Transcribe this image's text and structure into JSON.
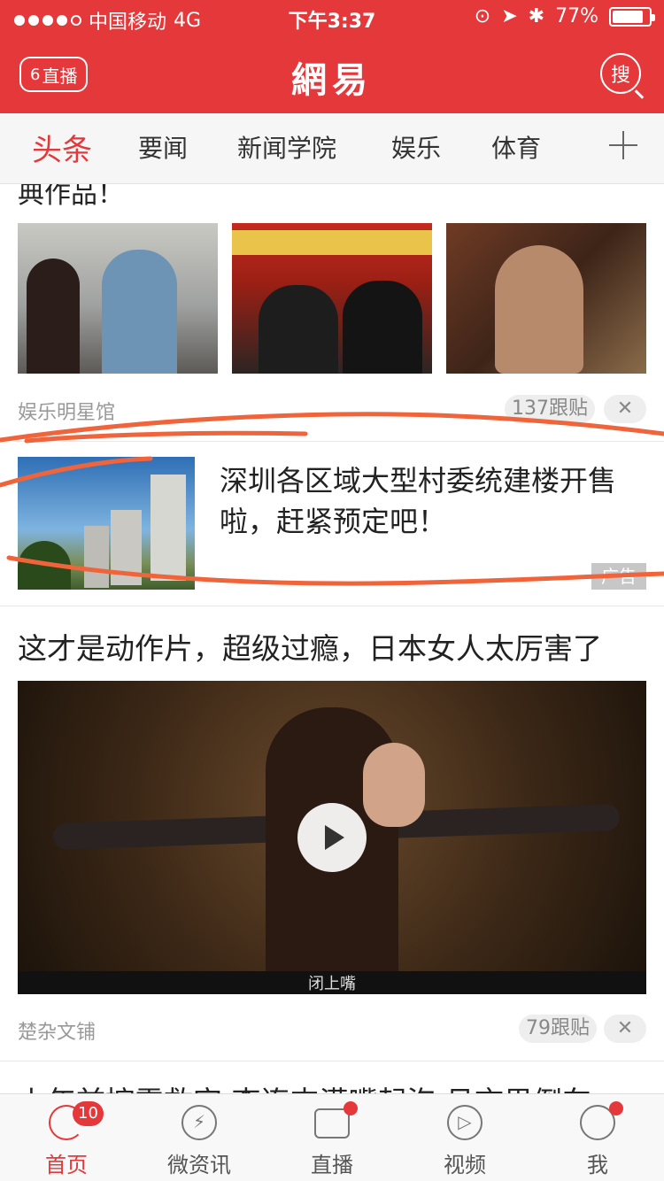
{
  "status_bar": {
    "carrier": "中国移动",
    "network": "4G",
    "time": "下午3:37",
    "battery": "77%"
  },
  "nav": {
    "live_count": "6",
    "live_label": "直播",
    "logo": "網易",
    "search_label": "搜"
  },
  "tabs": [
    {
      "label": "头条",
      "active": true
    },
    {
      "label": "要闻",
      "active": false
    },
    {
      "label": "新闻学院",
      "active": false
    },
    {
      "label": "娱乐",
      "active": false
    },
    {
      "label": "体育",
      "active": false
    }
  ],
  "feed": {
    "partial_title": "典作品！",
    "gallery": {
      "source": "娱乐明星馆",
      "comments": "137跟贴",
      "close": "✕"
    },
    "ad": {
      "title": "深圳各区域大型村委统建楼开售啦，赶紧预定吧！",
      "tag": "广告"
    },
    "video_item": {
      "title": "这才是动作片，超级过瘾，日本女人太厉害了",
      "subtitle": "闭上嘴",
      "source": "楚杂文铺",
      "comments": "79跟贴",
      "close": "✕"
    },
    "next_title": "上年前控需救定 李连杰满嘴起泡 吕言男倒车"
  },
  "bottom_tabs": [
    {
      "label": "首页",
      "icon": "refresh-icon",
      "badge": "10",
      "active": true
    },
    {
      "label": "微资讯",
      "icon": "lightning-icon",
      "active": false
    },
    {
      "label": "直播",
      "icon": "live-tv-icon",
      "dot": true,
      "active": false
    },
    {
      "label": "视频",
      "icon": "play-circle-icon",
      "active": false
    },
    {
      "label": "我",
      "icon": "user-icon",
      "dot": true,
      "active": false
    }
  ],
  "colors": {
    "brand_red": "#e5383b",
    "annotation_orange": "#f0643c"
  }
}
